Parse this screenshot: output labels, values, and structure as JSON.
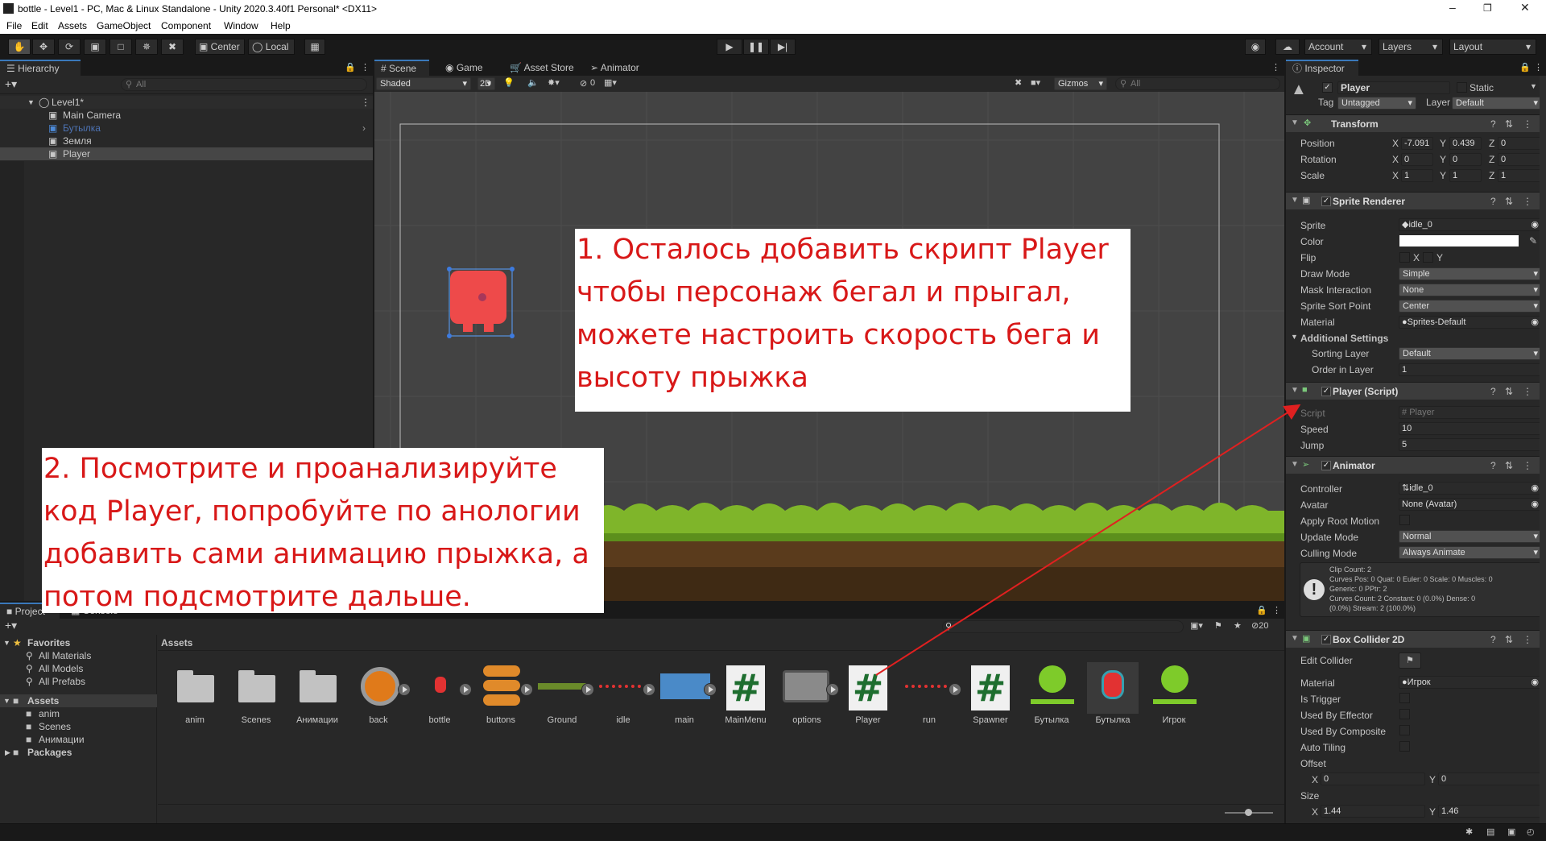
{
  "window": {
    "title": "bottle - Level1 - PC, Mac & Linux Standalone - Unity 2020.3.40f1 Personal* <DX11>"
  },
  "menu": [
    "File",
    "Edit",
    "Assets",
    "GameObject",
    "Component",
    "Window",
    "Help"
  ],
  "toolbar": {
    "center": "Center",
    "local": "Local",
    "account": "Account",
    "layers": "Layers",
    "layout": "Layout"
  },
  "hierarchy": {
    "tab": "Hierarchy",
    "search": "All",
    "scene": "Level1*",
    "items": [
      "Main Camera",
      "Бутылка",
      "Земля",
      "Player"
    ]
  },
  "scene_view": {
    "tabs": [
      "Scene",
      "Game",
      "Asset Store",
      "Animator"
    ],
    "shading": "Shaded",
    "mode_2d": "2D",
    "hidden_count": "0",
    "gizmos": "Gizmos",
    "search": "All"
  },
  "notes": {
    "note1": [
      "1. Осталось добавить скрипт Player",
      "чтобы персонаж бегал и прыгал,",
      "можете настроить скорость бега и",
      "высоту прыжка"
    ],
    "note2": [
      "2. Посмотрите и проанализируйте",
      "код Player, попробуйте по анологии",
      "добавить сами анимацию прыжка, а",
      "потом подсмотрите дальше."
    ]
  },
  "project": {
    "tabs": [
      "Project",
      "Console"
    ],
    "header": "Assets",
    "hidden_count": "20",
    "tree": {
      "favorites": "Favorites",
      "fav_items": [
        "All Materials",
        "All Models",
        "All Prefabs"
      ],
      "assets": "Assets",
      "asset_items": [
        "anim",
        "Scenes",
        "Анимации"
      ],
      "packages": "Packages"
    },
    "assets": [
      "anim",
      "Scenes",
      "Анимации",
      "back",
      "bottle",
      "buttons",
      "Ground",
      "idle",
      "main",
      "MainMenu",
      "options",
      "Player",
      "run",
      "Spawner",
      "Бутылка",
      "Бутылка",
      "Игрок"
    ]
  },
  "inspector": {
    "tab": "Inspector",
    "object": "Player",
    "static": "Static",
    "tag_label": "Tag",
    "tag": "Untagged",
    "layer_label": "Layer",
    "layer": "Default",
    "transform": {
      "title": "Transform",
      "rows": [
        {
          "label": "Position",
          "x": "-7.091",
          "y": "0.439",
          "z": "0"
        },
        {
          "label": "Rotation",
          "x": "0",
          "y": "0",
          "z": "0"
        },
        {
          "label": "Scale",
          "x": "1",
          "y": "1",
          "z": "1"
        }
      ]
    },
    "sprite_renderer": {
      "title": "Sprite Renderer",
      "sprite_label": "Sprite",
      "sprite": "idle_0",
      "color_label": "Color",
      "flip_label": "Flip",
      "flip_x": "X",
      "flip_y": "Y",
      "draw_mode_label": "Draw Mode",
      "draw_mode": "Simple",
      "mask_label": "Mask Interaction",
      "mask": "None",
      "sort_point_label": "Sprite Sort Point",
      "sort_point": "Center",
      "material_label": "Material",
      "material": "Sprites-Default",
      "additional": "Additional Settings",
      "sorting_layer_label": "Sorting Layer",
      "sorting_layer": "Default",
      "order_label": "Order in Layer",
      "order": "1"
    },
    "player_script": {
      "title": "Player (Script)",
      "script_label": "Script",
      "script": "Player",
      "speed_label": "Speed",
      "speed": "10",
      "jump_label": "Jump",
      "jump": "5"
    },
    "animator": {
      "title": "Animator",
      "controller_label": "Controller",
      "controller": "idle_0",
      "avatar_label": "Avatar",
      "avatar": "None (Avatar)",
      "root_motion_label": "Apply Root Motion",
      "update_label": "Update Mode",
      "update": "Normal",
      "culling_label": "Culling Mode",
      "culling": "Always Animate",
      "info": [
        "Clip Count: 2",
        "Curves Pos: 0 Quat: 0 Euler: 0 Scale: 0 Muscles: 0",
        "Generic: 0 PPtr: 2",
        "Curves Count: 2 Constant: 0 (0.0%) Dense: 0",
        "(0.0%) Stream: 2 (100.0%)"
      ]
    },
    "box_collider": {
      "title": "Box Collider 2D",
      "edit_label": "Edit Collider",
      "material_label": "Material",
      "material": "Игрок",
      "trigger_label": "Is Trigger",
      "effector_label": "Used By Effector",
      "composite_label": "Used By Composite",
      "tiling_label": "Auto Tiling",
      "offset_label": "Offset",
      "offset_x": "0",
      "offset_y": "0",
      "size_label": "Size",
      "size_x": "1.44",
      "size_y": "1.46",
      "x": "X",
      "y": "Y"
    }
  }
}
